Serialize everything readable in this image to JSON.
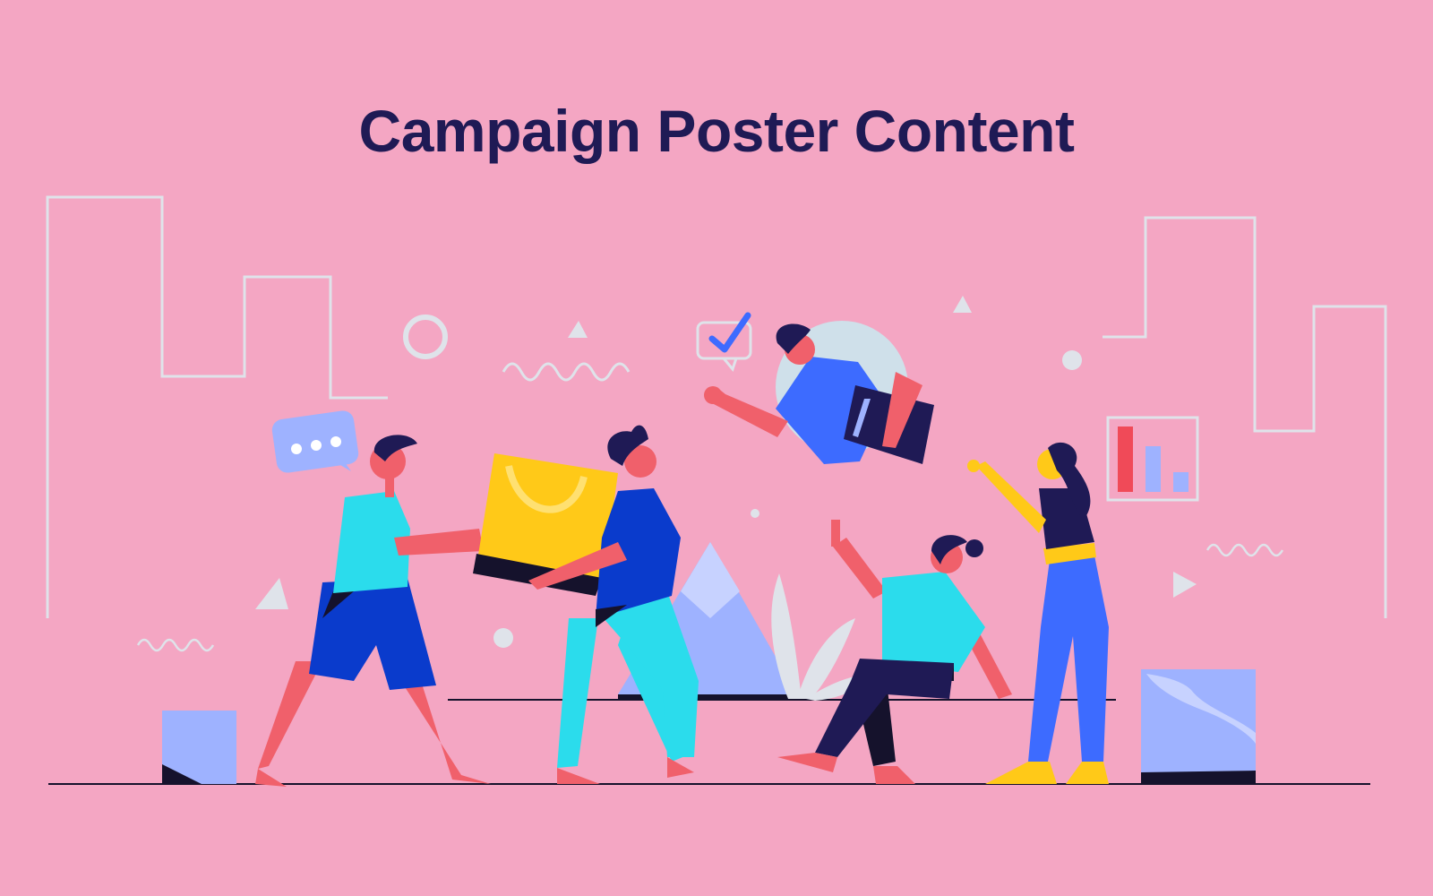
{
  "poster": {
    "title": "Campaign Poster Content"
  },
  "colors": {
    "background": "#f4a6c3",
    "title": "#1f1a55",
    "outline": "#dfe3ea",
    "skin": "#f0606b",
    "cyan": "#2bdcec",
    "royal_blue": "#0a3bcc",
    "periwinkle": "#9eb2ff",
    "navy": "#1f1a55",
    "yellow": "#ffc918",
    "bright_blue": "#3d6bff",
    "red": "#f04a58",
    "ink": "#15122c"
  },
  "icons": {
    "chat_bubble": "speech-bubble-dots-icon",
    "checkmark_bubble": "speech-bubble-check-icon",
    "bar_chart": "bar-chart-frame-icon"
  }
}
